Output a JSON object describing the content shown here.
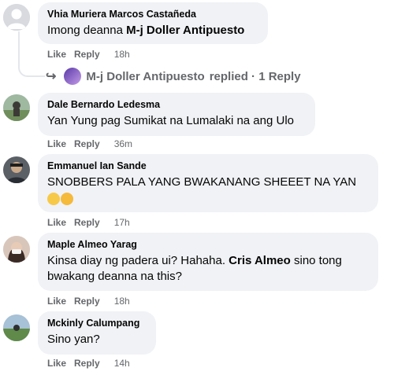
{
  "comments": [
    {
      "author": "Vhia Muriera Marcos Castañeda",
      "text_prefix": "Imong deanna ",
      "mention": "M-j Doller Antipuesto",
      "text_suffix": "",
      "like": "Like",
      "reply": "Reply",
      "time": "18h",
      "replies": {
        "name": "M-j Doller Antipuesto",
        "label": "replied · 1 Reply"
      }
    },
    {
      "author": "Dale Bernardo Ledesma",
      "text": "Yan Yung pag Sumikat na Lumalaki na ang Ulo",
      "like": "Like",
      "reply": "Reply",
      "time": "36m"
    },
    {
      "author": "Emmanuel Ian Sande",
      "text": "SNOBBERS PALA YANG BWAKANANG SHEEET NA YAN",
      "emojis": [
        "grinning-sweat-emoji",
        "flushed-emoji"
      ],
      "like": "Like",
      "reply": "Reply",
      "time": "17h"
    },
    {
      "author": "Maple Almeo Yarag",
      "text_prefix": "Kinsa diay ng padera ui? Hahaha. ",
      "mention": "Cris Almeo",
      "text_suffix": " sino tong bwakang deanna na this?",
      "like": "Like",
      "reply": "Reply",
      "time": "18h"
    },
    {
      "author": "Mckinly Calumpang",
      "text": "Sino yan?",
      "like": "Like",
      "reply": "Reply",
      "time": "14h"
    }
  ],
  "colors": {
    "bubble": "#f0f2f5",
    "meta": "#65676b",
    "text": "#050505"
  }
}
